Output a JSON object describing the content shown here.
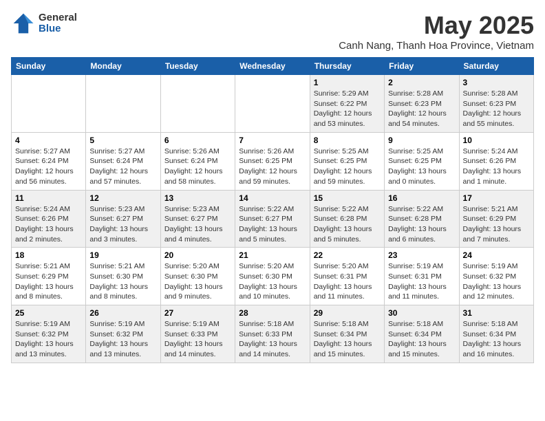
{
  "header": {
    "logo_general": "General",
    "logo_blue": "Blue",
    "month_title": "May 2025",
    "location": "Canh Nang, Thanh Hoa Province, Vietnam"
  },
  "weekdays": [
    "Sunday",
    "Monday",
    "Tuesday",
    "Wednesday",
    "Thursday",
    "Friday",
    "Saturday"
  ],
  "weeks": [
    [
      {
        "day": "",
        "info": ""
      },
      {
        "day": "",
        "info": ""
      },
      {
        "day": "",
        "info": ""
      },
      {
        "day": "",
        "info": ""
      },
      {
        "day": "1",
        "info": "Sunrise: 5:29 AM\nSunset: 6:22 PM\nDaylight: 12 hours\nand 53 minutes."
      },
      {
        "day": "2",
        "info": "Sunrise: 5:28 AM\nSunset: 6:23 PM\nDaylight: 12 hours\nand 54 minutes."
      },
      {
        "day": "3",
        "info": "Sunrise: 5:28 AM\nSunset: 6:23 PM\nDaylight: 12 hours\nand 55 minutes."
      }
    ],
    [
      {
        "day": "4",
        "info": "Sunrise: 5:27 AM\nSunset: 6:24 PM\nDaylight: 12 hours\nand 56 minutes."
      },
      {
        "day": "5",
        "info": "Sunrise: 5:27 AM\nSunset: 6:24 PM\nDaylight: 12 hours\nand 57 minutes."
      },
      {
        "day": "6",
        "info": "Sunrise: 5:26 AM\nSunset: 6:24 PM\nDaylight: 12 hours\nand 58 minutes."
      },
      {
        "day": "7",
        "info": "Sunrise: 5:26 AM\nSunset: 6:25 PM\nDaylight: 12 hours\nand 59 minutes."
      },
      {
        "day": "8",
        "info": "Sunrise: 5:25 AM\nSunset: 6:25 PM\nDaylight: 12 hours\nand 59 minutes."
      },
      {
        "day": "9",
        "info": "Sunrise: 5:25 AM\nSunset: 6:25 PM\nDaylight: 13 hours\nand 0 minutes."
      },
      {
        "day": "10",
        "info": "Sunrise: 5:24 AM\nSunset: 6:26 PM\nDaylight: 13 hours\nand 1 minute."
      }
    ],
    [
      {
        "day": "11",
        "info": "Sunrise: 5:24 AM\nSunset: 6:26 PM\nDaylight: 13 hours\nand 2 minutes."
      },
      {
        "day": "12",
        "info": "Sunrise: 5:23 AM\nSunset: 6:27 PM\nDaylight: 13 hours\nand 3 minutes."
      },
      {
        "day": "13",
        "info": "Sunrise: 5:23 AM\nSunset: 6:27 PM\nDaylight: 13 hours\nand 4 minutes."
      },
      {
        "day": "14",
        "info": "Sunrise: 5:22 AM\nSunset: 6:27 PM\nDaylight: 13 hours\nand 5 minutes."
      },
      {
        "day": "15",
        "info": "Sunrise: 5:22 AM\nSunset: 6:28 PM\nDaylight: 13 hours\nand 5 minutes."
      },
      {
        "day": "16",
        "info": "Sunrise: 5:22 AM\nSunset: 6:28 PM\nDaylight: 13 hours\nand 6 minutes."
      },
      {
        "day": "17",
        "info": "Sunrise: 5:21 AM\nSunset: 6:29 PM\nDaylight: 13 hours\nand 7 minutes."
      }
    ],
    [
      {
        "day": "18",
        "info": "Sunrise: 5:21 AM\nSunset: 6:29 PM\nDaylight: 13 hours\nand 8 minutes."
      },
      {
        "day": "19",
        "info": "Sunrise: 5:21 AM\nSunset: 6:30 PM\nDaylight: 13 hours\nand 8 minutes."
      },
      {
        "day": "20",
        "info": "Sunrise: 5:20 AM\nSunset: 6:30 PM\nDaylight: 13 hours\nand 9 minutes."
      },
      {
        "day": "21",
        "info": "Sunrise: 5:20 AM\nSunset: 6:30 PM\nDaylight: 13 hours\nand 10 minutes."
      },
      {
        "day": "22",
        "info": "Sunrise: 5:20 AM\nSunset: 6:31 PM\nDaylight: 13 hours\nand 11 minutes."
      },
      {
        "day": "23",
        "info": "Sunrise: 5:19 AM\nSunset: 6:31 PM\nDaylight: 13 hours\nand 11 minutes."
      },
      {
        "day": "24",
        "info": "Sunrise: 5:19 AM\nSunset: 6:32 PM\nDaylight: 13 hours\nand 12 minutes."
      }
    ],
    [
      {
        "day": "25",
        "info": "Sunrise: 5:19 AM\nSunset: 6:32 PM\nDaylight: 13 hours\nand 13 minutes."
      },
      {
        "day": "26",
        "info": "Sunrise: 5:19 AM\nSunset: 6:32 PM\nDaylight: 13 hours\nand 13 minutes."
      },
      {
        "day": "27",
        "info": "Sunrise: 5:19 AM\nSunset: 6:33 PM\nDaylight: 13 hours\nand 14 minutes."
      },
      {
        "day": "28",
        "info": "Sunrise: 5:18 AM\nSunset: 6:33 PM\nDaylight: 13 hours\nand 14 minutes."
      },
      {
        "day": "29",
        "info": "Sunrise: 5:18 AM\nSunset: 6:34 PM\nDaylight: 13 hours\nand 15 minutes."
      },
      {
        "day": "30",
        "info": "Sunrise: 5:18 AM\nSunset: 6:34 PM\nDaylight: 13 hours\nand 15 minutes."
      },
      {
        "day": "31",
        "info": "Sunrise: 5:18 AM\nSunset: 6:34 PM\nDaylight: 13 hours\nand 16 minutes."
      }
    ]
  ]
}
